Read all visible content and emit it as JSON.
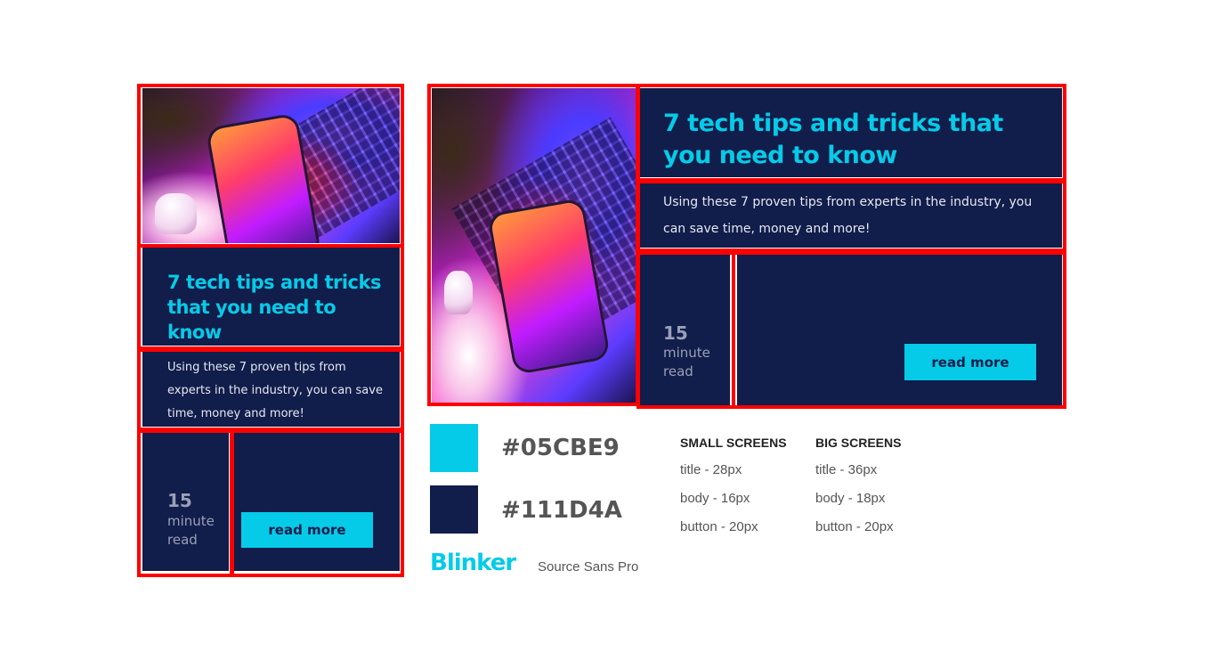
{
  "small_card": {
    "title": "7 tech tips and tricks that you need to know",
    "body": "Using these 7 proven tips from experts in the industry, you can save time, money and more!",
    "read_time_number": "15",
    "read_time_unit": "minute read",
    "button_label": "read more",
    "image_icon": "laptop-phone-photo"
  },
  "big_card": {
    "title": "7 tech tips and tricks that you need to know",
    "body": "Using these 7 proven tips from experts in the industry, you can save time, money and more!",
    "read_time_number": "15",
    "read_time_unit": "minute read",
    "button_label": "read more",
    "image_icon": "laptop-phone-photo"
  },
  "style_guide": {
    "colors": [
      {
        "hex": "#05CBE9"
      },
      {
        "hex": "#111D4A"
      }
    ],
    "fonts": {
      "primary": "Blinker",
      "secondary": "Source Sans Pro"
    },
    "small_screens": {
      "heading": "SMALL SCREENS",
      "items": [
        "title - 28px",
        "body - 16px",
        "button - 20px"
      ]
    },
    "big_screens": {
      "heading": "BIG SCREENS",
      "items": [
        "title - 36px",
        "body - 18px",
        "button - 20px"
      ]
    }
  },
  "colors": {
    "accent": "#05cbe9",
    "navy": "#111d4a",
    "outline": "#ff0000"
  }
}
